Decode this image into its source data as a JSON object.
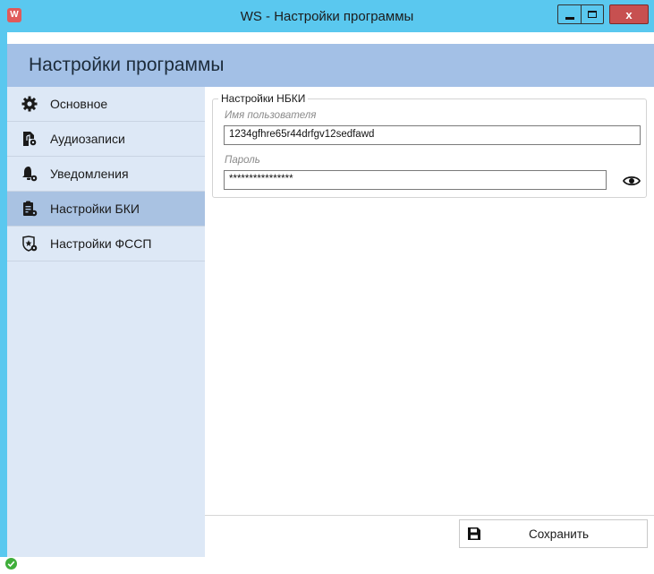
{
  "window": {
    "title": "WS - Настройки программы",
    "app_icon": "W",
    "buttons": {
      "minimize": "minimize-icon",
      "maximize": "maximize-icon",
      "close": "x"
    },
    "accent": "#5ac8ef"
  },
  "header": {
    "title": "Настройки программы"
  },
  "sidebar": {
    "items": [
      {
        "label": "Основное",
        "icon": "gear-icon",
        "active": false
      },
      {
        "label": "Аудиозаписи",
        "icon": "audio-file-settings-icon",
        "active": false
      },
      {
        "label": "Уведомления",
        "icon": "bell-settings-icon",
        "active": false
      },
      {
        "label": "Настройки БКИ",
        "icon": "clipboard-settings-icon",
        "active": true
      },
      {
        "label": "Настройки ФССП",
        "icon": "badge-settings-icon",
        "active": false
      }
    ]
  },
  "main": {
    "group_title": "Настройки НБКИ",
    "username": {
      "label": "Имя пользователя",
      "value": "1234gfhre65r44drfgv12sedfawd"
    },
    "password": {
      "label": "Пароль",
      "value": "****************"
    }
  },
  "footer": {
    "save_label": "Сохранить"
  },
  "status": {
    "icon": "status-ok-icon",
    "color": "#3fae3a"
  }
}
